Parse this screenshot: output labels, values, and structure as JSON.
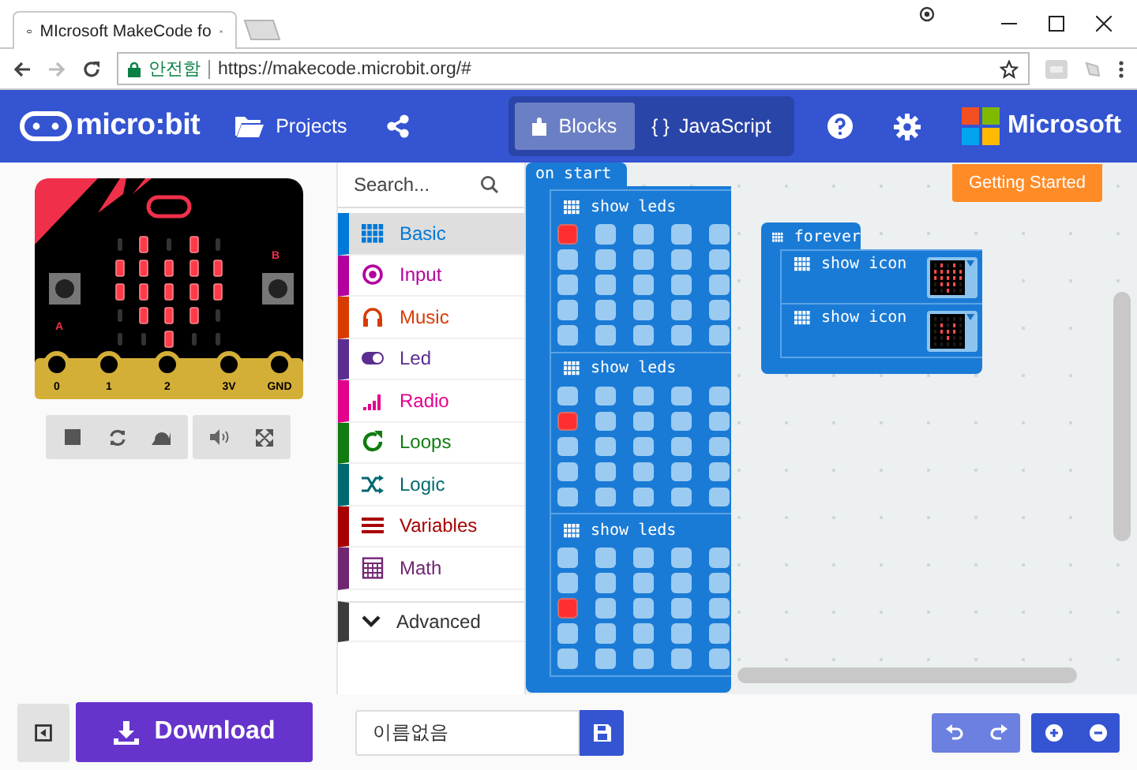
{
  "browser": {
    "tab": {
      "title": "MIcrosoft MakeCode fo"
    },
    "address": {
      "security": "안전함",
      "url": "https://makecode.microbit.org/#"
    }
  },
  "header": {
    "logo": "micro:bit",
    "projects": "Projects",
    "modes": [
      {
        "kind": "blocks",
        "label": "Blocks",
        "selected": true
      },
      {
        "kind": "code",
        "icon": "{ }",
        "label": "JavaScript",
        "selected": false
      }
    ],
    "brand": "Microsoft"
  },
  "simulator": {
    "leds": [
      [
        false,
        true,
        false,
        true,
        false
      ],
      [
        true,
        true,
        true,
        true,
        true
      ],
      [
        true,
        true,
        true,
        true,
        true
      ],
      [
        false,
        true,
        true,
        true,
        false
      ],
      [
        false,
        false,
        true,
        false,
        false
      ]
    ],
    "pins": [
      "0",
      "1",
      "2",
      "3V",
      "GND"
    ],
    "buttons": [
      "A",
      "B"
    ]
  },
  "toolbox": {
    "placeholder": "Search...",
    "categories": [
      {
        "kind": "basic",
        "label": "Basic",
        "color": "#0078d7",
        "selected": true
      },
      {
        "kind": "input",
        "label": "Input",
        "color": "#b4009e",
        "selected": false
      },
      {
        "kind": "music",
        "label": "Music",
        "color": "#d83b01",
        "selected": false
      },
      {
        "kind": "led",
        "label": "Led",
        "color": "#5c2d91",
        "selected": false
      },
      {
        "kind": "radio",
        "label": "Radio",
        "color": "#e3008c",
        "selected": false
      },
      {
        "kind": "loops",
        "label": "Loops",
        "color": "#107c10",
        "selected": false
      },
      {
        "kind": "logic",
        "label": "Logic",
        "color": "#006970",
        "selected": false
      },
      {
        "kind": "variables",
        "label": "Variables",
        "color": "#a80000",
        "selected": false
      },
      {
        "kind": "math",
        "label": "Math",
        "color": "#712672",
        "selected": false
      }
    ],
    "advanced": {
      "label": "Advanced",
      "color": "#3c3c3c"
    }
  },
  "workspace": {
    "getting_started": "Getting Started",
    "on_start": {
      "label": "on start",
      "children": [
        {
          "label": "show leds",
          "leds": [
            [
              true,
              false,
              false,
              false,
              false
            ],
            [
              false,
              false,
              false,
              false,
              false
            ],
            [
              false,
              false,
              false,
              false,
              false
            ],
            [
              false,
              false,
              false,
              false,
              false
            ],
            [
              false,
              false,
              false,
              false,
              false
            ]
          ]
        },
        {
          "label": "show leds",
          "leds": [
            [
              false,
              false,
              false,
              false,
              false
            ],
            [
              true,
              false,
              false,
              false,
              false
            ],
            [
              false,
              false,
              false,
              false,
              false
            ],
            [
              false,
              false,
              false,
              false,
              false
            ],
            [
              false,
              false,
              false,
              false,
              false
            ]
          ]
        },
        {
          "label": "show leds",
          "leds": [
            [
              false,
              false,
              false,
              false,
              false
            ],
            [
              false,
              false,
              false,
              false,
              false
            ],
            [
              true,
              false,
              false,
              false,
              false
            ],
            [
              false,
              false,
              false,
              false,
              false
            ],
            [
              false,
              false,
              false,
              false,
              false
            ]
          ]
        }
      ]
    },
    "forever": {
      "label": "forever",
      "children": [
        {
          "label": "show icon",
          "leds": [
            [
              false,
              true,
              false,
              true,
              false
            ],
            [
              true,
              true,
              true,
              true,
              true
            ],
            [
              true,
              true,
              true,
              true,
              true
            ],
            [
              false,
              true,
              true,
              true,
              false
            ],
            [
              false,
              false,
              true,
              false,
              false
            ]
          ]
        },
        {
          "label": "show icon",
          "leds": [
            [
              false,
              false,
              false,
              false,
              false
            ],
            [
              false,
              true,
              false,
              true,
              false
            ],
            [
              false,
              true,
              true,
              true,
              false
            ],
            [
              false,
              false,
              true,
              false,
              false
            ],
            [
              false,
              false,
              false,
              false,
              false
            ]
          ]
        }
      ]
    }
  },
  "footer": {
    "download": "Download",
    "project_name": "이름없음"
  }
}
